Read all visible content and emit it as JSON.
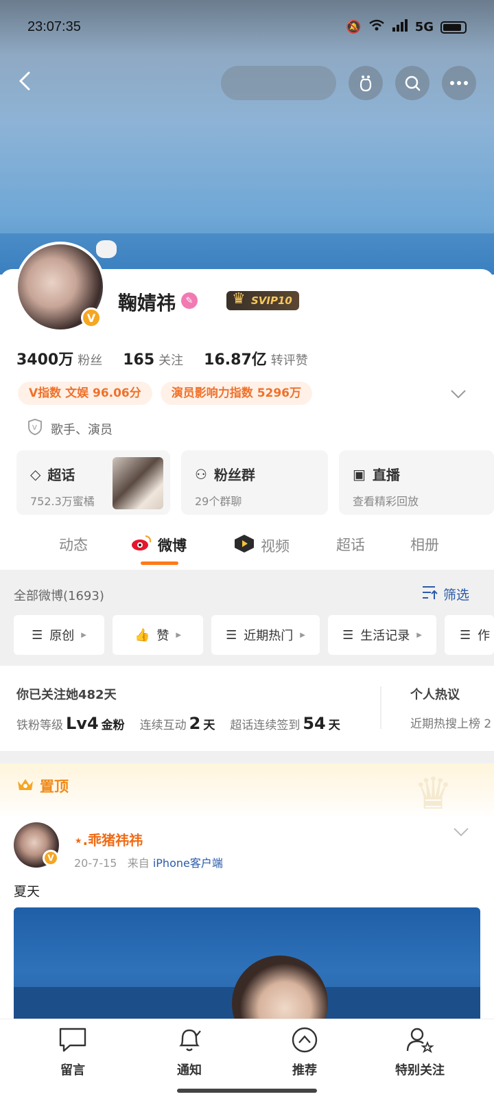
{
  "status_bar": {
    "time": "23:07:35",
    "network": "5G"
  },
  "profile": {
    "name": "鞠婧祎",
    "svip": "SVIP10",
    "stats": [
      {
        "num": "3400万",
        "label": "粉丝"
      },
      {
        "num": "165",
        "label": "关注"
      },
      {
        "num": "16.87亿",
        "label": "转评赞"
      }
    ],
    "tags": [
      "V指数  文娱  96.06分",
      "演员影响力指数  5296万"
    ],
    "role": "歌手、演员"
  },
  "tiles": [
    {
      "title": "超话",
      "sub": "752.3万蜜橘"
    },
    {
      "title": "粉丝群",
      "sub": "29个群聊"
    },
    {
      "title": "直播",
      "sub": "查看精彩回放"
    }
  ],
  "tabs": [
    "动态",
    "微博",
    "视频",
    "超话",
    "相册"
  ],
  "filter": {
    "all_label": "全部微博(1693)",
    "filter_label": "筛选",
    "chips": [
      "原创",
      "赞",
      "近期热门",
      "生活记录",
      "作"
    ]
  },
  "fan_info": {
    "follow_days": "你已关注她482天",
    "level_label": "铁粉等级",
    "level_value": "Lv4",
    "level_suffix": "金粉",
    "interact_label": "连续互动",
    "interact_value": "2",
    "interact_unit": "天",
    "checkin_label": "超话连续签到",
    "checkin_value": "54",
    "checkin_unit": "天",
    "hot_title": "个人热议",
    "hot_sub": "近期热搜上榜 2"
  },
  "pinned": {
    "label": "置顶"
  },
  "post": {
    "username": "⋆.乖猪祎祎",
    "date": "20-7-15",
    "from": "来自",
    "source": "iPhone客户端",
    "text": "夏天"
  },
  "bottom_nav": [
    "留言",
    "通知",
    "推荐",
    "特别关注"
  ],
  "colors": {
    "accent": "#ff7a1a",
    "link": "#2a5aa8",
    "tag_bg": "#fff1e8"
  }
}
